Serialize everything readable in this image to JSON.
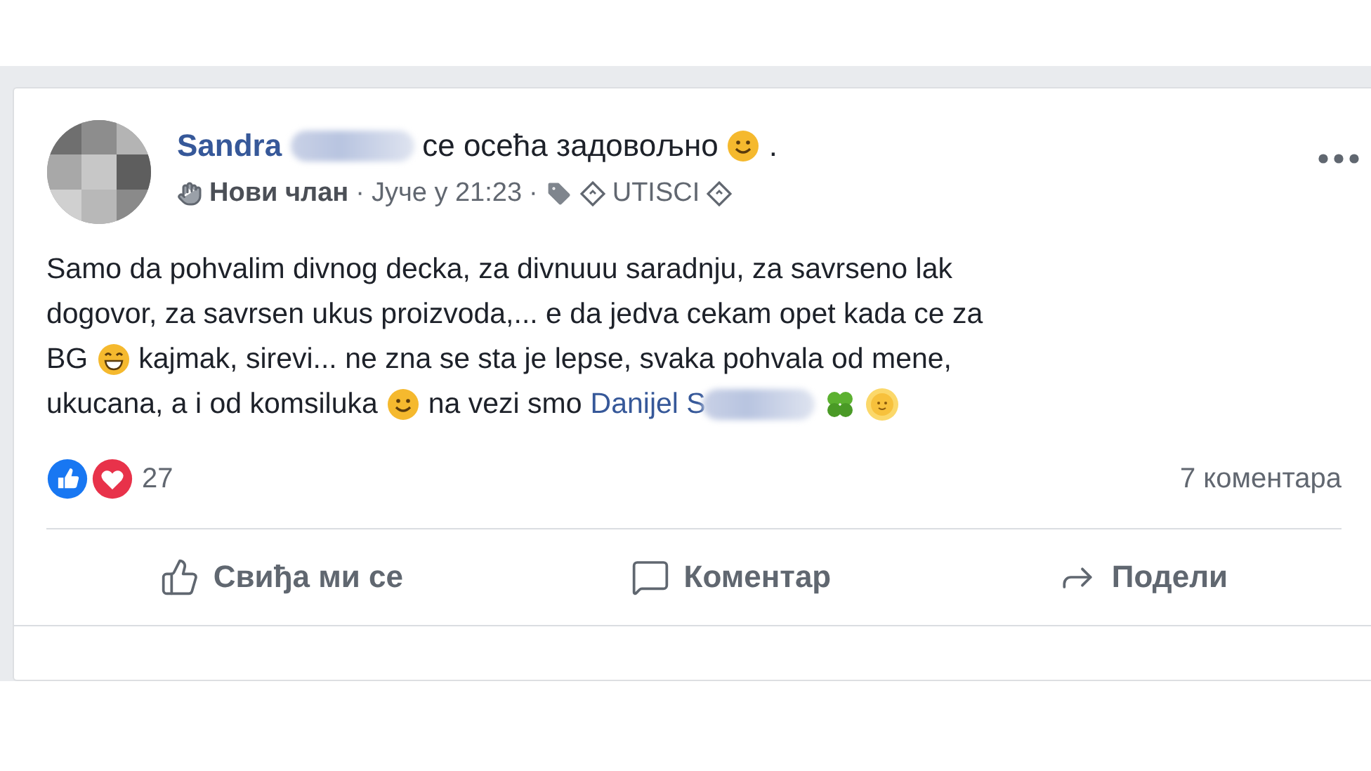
{
  "post": {
    "author": "Sandra",
    "feeling": "се осећа задовољно",
    "feeling_tail": ".",
    "meta": {
      "badge": "Нови члан",
      "time": "Јуче у 21:23",
      "group": "UTISCI",
      "separators": [
        "·",
        "·"
      ]
    },
    "body": [
      [
        {
          "kind": "text",
          "text": "Samo da pohvalim divnog decka, za divnuuu saradnju, za savrseno lak"
        }
      ],
      [
        {
          "kind": "text",
          "text": "dogovor, za savrsen ukus proizvoda,... e da jedva cekam opet kada ce za"
        }
      ],
      [
        {
          "kind": "text",
          "text": "BG"
        },
        {
          "kind": "grin"
        },
        {
          "kind": "text",
          "text": "kajmak, sirevi... ne zna se sta je lepse, svaka pohvala od mene,"
        }
      ],
      [
        {
          "kind": "text",
          "text": "ukucana, a i od komsiluka"
        },
        {
          "kind": "smile"
        },
        {
          "kind": "text",
          "text": "na vezi smo"
        },
        {
          "kind": "link",
          "text": "Danijel S"
        },
        {
          "kind": "blur"
        },
        {
          "kind": "clover"
        },
        {
          "kind": "sun"
        }
      ]
    ],
    "reactions": {
      "count": "27"
    },
    "comments": "7 коментара",
    "actions": [
      {
        "label": "Свиђа ми се"
      },
      {
        "label": "Коментар"
      },
      {
        "label": "Подели"
      }
    ]
  }
}
